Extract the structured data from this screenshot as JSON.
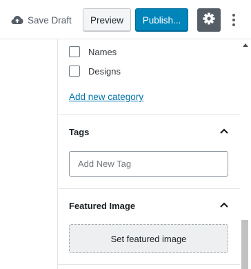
{
  "toolbar": {
    "save_draft_label": "Save Draft",
    "preview_label": "Preview",
    "publish_label": "Publish...",
    "cloud_icon": "cloud-upload-icon",
    "settings_icon": "gear-icon",
    "more_icon": "more-vertical-icon"
  },
  "categories": {
    "items": [
      {
        "label": "Names",
        "checked": false
      },
      {
        "label": "Designs",
        "checked": false
      }
    ],
    "add_new_label": "Add new category"
  },
  "tags": {
    "title": "Tags",
    "expanded": true,
    "input_placeholder": "Add New Tag",
    "input_value": ""
  },
  "featured_image": {
    "title": "Featured Image",
    "expanded": true,
    "button_label": "Set featured image"
  },
  "colors": {
    "accent": "#0085ba",
    "link": "#0073aa",
    "settings_active": "#555d66"
  }
}
